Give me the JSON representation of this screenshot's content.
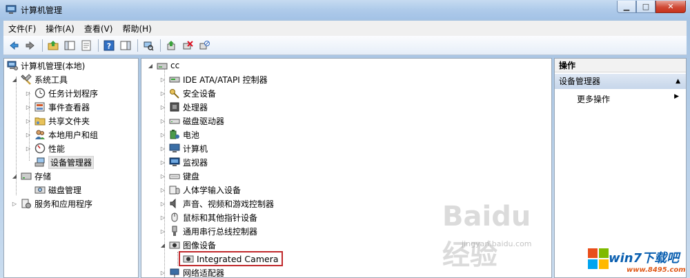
{
  "window": {
    "title": "计算机管理"
  },
  "menubar": [
    "文件(F)",
    "操作(A)",
    "查看(V)",
    "帮助(H)"
  ],
  "toolbar": [
    "back-icon",
    "forward-icon",
    "up-folder-icon",
    "show-hide-tree-icon",
    "properties-icon",
    "help-icon",
    "show-hide-action-pane-icon",
    "scan-hardware-icon",
    "update-driver-icon",
    "uninstall-icon",
    "disable-device-icon"
  ],
  "left_tree": {
    "root": "计算机管理(本地)",
    "system_tools": "系统工具",
    "task_scheduler": "任务计划程序",
    "event_viewer": "事件查看器",
    "shared_folders": "共享文件夹",
    "local_users": "本地用户和组",
    "performance": "性能",
    "device_manager": "设备管理器",
    "storage": "存储",
    "disk_management": "磁盘管理",
    "services_apps": "服务和应用程序"
  },
  "device_tree": {
    "root": "cc",
    "items": [
      "IDE ATA/ATAPI 控制器",
      "安全设备",
      "处理器",
      "磁盘驱动器",
      "电池",
      "计算机",
      "监视器",
      "键盘",
      "人体学输入设备",
      "声音、视频和游戏控制器",
      "鼠标和其他指针设备",
      "通用串行总线控制器",
      "图像设备"
    ],
    "camera": "Integrated Camera",
    "network": "网络适配器"
  },
  "actions": {
    "header": "操作",
    "group": "设备管理器",
    "more": "更多操作"
  },
  "watermark": {
    "main": "Baidu经验",
    "sub": "jingyan.baidu.com"
  },
  "badge": {
    "text": "win7下载吧",
    "url": "www.8495.com"
  }
}
